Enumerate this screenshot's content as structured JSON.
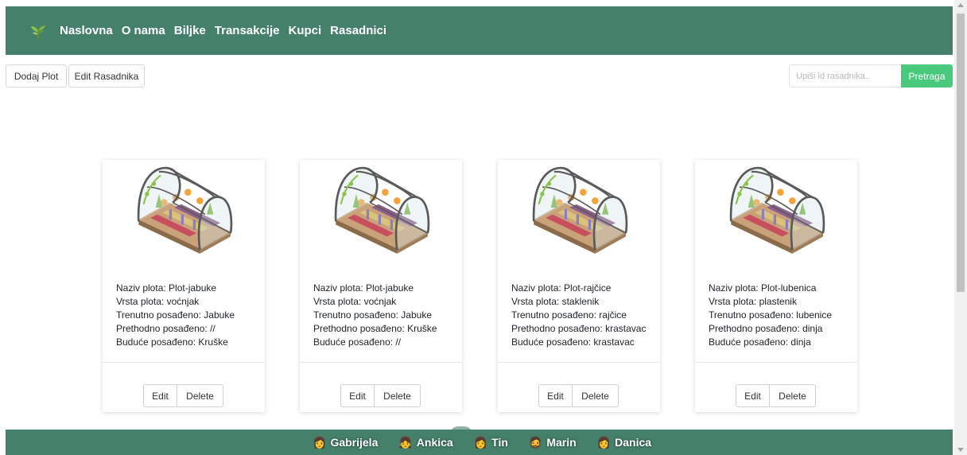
{
  "nav": {
    "logo_icon": "sprout-icon",
    "links": [
      "Naslovna",
      "O nama",
      "Biljke",
      "Transakcije",
      "Kupci",
      "Rasadnici"
    ]
  },
  "toolbar": {
    "add_label": "Dodaj Plot",
    "edit_label": "Edit Rasadnika"
  },
  "search": {
    "placeholder": "Upiši id rasadnika..",
    "button_label": "Pretraga"
  },
  "cards": [
    {
      "name": "Naziv plota: Plot-jabuke",
      "type": "Vrsta plota: voćnjak",
      "current": "Trenutno posađeno: Jabuke",
      "previous": "Prethodno posađeno: //",
      "future": "Buduće posađeno: Kruške",
      "edit": "Edit",
      "delete": "Delete"
    },
    {
      "name": "Naziv plota: Plot-jabuke",
      "type": "Vrsta plota: voćnjak",
      "current": "Trenutno posađeno: Jabuke",
      "previous": "Prethodno posađeno: Kruške",
      "future": "Buduće posađeno: //",
      "edit": "Edit",
      "delete": "Delete"
    },
    {
      "name": "Naziv plota: Plot-rajčice",
      "type": "Vrsta plota: staklenik",
      "current": "Trenutno posađeno: rajčice",
      "previous": "Prethodno posađeno: krastavac",
      "future": "Buduće posađeno: krastavac",
      "edit": "Edit",
      "delete": "Delete"
    },
    {
      "name": "Naziv plota: Plot-lubenica",
      "type": "Vrsta plota: plastenik",
      "current": "Trenutno posađeno: lubenice",
      "previous": "Prethodno posađeno: dinja",
      "future": "Buduće posađeno: dinja",
      "edit": "Edit",
      "delete": "Delete"
    }
  ],
  "footer": {
    "people": [
      {
        "emoji": "👩",
        "name": "Gabrijela"
      },
      {
        "emoji": "👧",
        "name": "Ankica"
      },
      {
        "emoji": "👩",
        "name": "Tin"
      },
      {
        "emoji": "🧔",
        "name": "Marin"
      },
      {
        "emoji": "👩",
        "name": "Danica"
      }
    ]
  },
  "colors": {
    "brand_green": "#45806b",
    "search_button": "#48c97b"
  }
}
